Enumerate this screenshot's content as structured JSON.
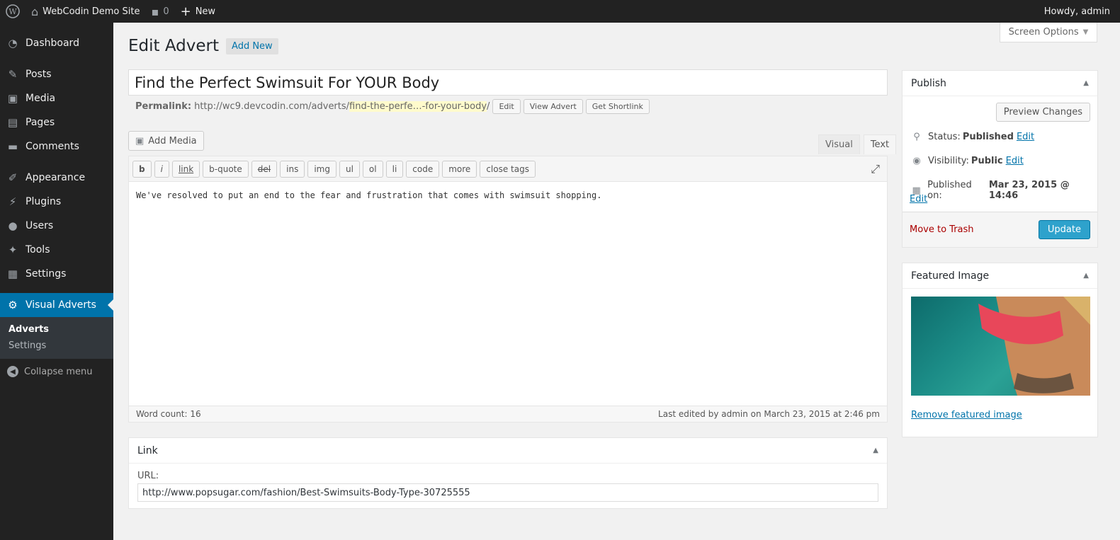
{
  "admin_bar": {
    "site_name": "WebCodin Demo Site",
    "comments_count": "0",
    "new_label": "New",
    "howdy": "Howdy, admin"
  },
  "sidebar": {
    "items": [
      {
        "label": "Dashboard",
        "icon": "dashboard-icon"
      },
      {
        "label": "Posts",
        "icon": "pin-icon"
      },
      {
        "label": "Media",
        "icon": "media-icon"
      },
      {
        "label": "Pages",
        "icon": "pages-icon"
      },
      {
        "label": "Comments",
        "icon": "comments-icon"
      },
      {
        "label": "Appearance",
        "icon": "brush-icon"
      },
      {
        "label": "Plugins",
        "icon": "plugin-icon"
      },
      {
        "label": "Users",
        "icon": "user-icon"
      },
      {
        "label": "Tools",
        "icon": "wrench-icon"
      },
      {
        "label": "Settings",
        "icon": "settings-icon"
      },
      {
        "label": "Visual Adverts",
        "icon": "gear-icon"
      }
    ],
    "submenu": [
      "Adverts",
      "Settings"
    ],
    "collapse": "Collapse menu"
  },
  "screen_options": "Screen Options",
  "page": {
    "title": "Edit Advert",
    "add_new": "Add New"
  },
  "post": {
    "title": "Find the Perfect Swimsuit For YOUR Body",
    "permalink_label": "Permalink:",
    "permalink_base": "http://wc9.devcodin.com/adverts/",
    "permalink_slug": "find-the-perfe…-for-your-body",
    "permalink_tail": "/",
    "edit_btn": "Edit",
    "view_btn": "View Advert",
    "shortlink_btn": "Get Shortlink"
  },
  "editor": {
    "add_media": "Add Media",
    "tab_visual": "Visual",
    "tab_text": "Text",
    "qt_buttons": [
      "b",
      "i",
      "link",
      "b-quote",
      "del",
      "ins",
      "img",
      "ul",
      "ol",
      "li",
      "code",
      "more",
      "close tags"
    ],
    "content": "We've resolved to put an end to the fear and frustration that comes with swimsuit shopping.",
    "word_count": "Word count: 16",
    "last_edited": "Last edited by admin on March 23, 2015 at 2:46 pm"
  },
  "link_box": {
    "title": "Link",
    "url_label": "URL:",
    "url_value": "http://www.popsugar.com/fashion/Best-Swimsuits-Body-Type-30725555"
  },
  "publish": {
    "title": "Publish",
    "preview": "Preview Changes",
    "status_label": "Status:",
    "status_value": "Published",
    "visibility_label": "Visibility:",
    "visibility_value": "Public",
    "published_on_label": "Published on:",
    "published_on_value": "Mar 23, 2015 @ 14:46",
    "edit": "Edit",
    "trash": "Move to Trash",
    "update": "Update"
  },
  "featured": {
    "title": "Featured Image",
    "remove": "Remove featured image"
  },
  "colors": {
    "accent": "#0073aa",
    "admin_bar": "#222222",
    "update_button": "#2ea2cc"
  }
}
